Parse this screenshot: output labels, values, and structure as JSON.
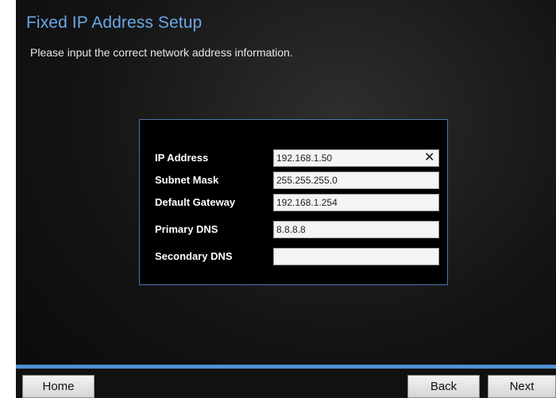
{
  "header": {
    "title": "Fixed IP Address Setup",
    "subtitle": "Please input the correct network address information."
  },
  "form": {
    "fields": [
      {
        "label": "IP Address",
        "value": "192.168.1.50"
      },
      {
        "label": "Subnet Mask",
        "value": "255.255.255.0"
      },
      {
        "label": "Default Gateway",
        "value": "192.168.1.254"
      },
      {
        "label": "Primary DNS",
        "value": "8.8.8.8"
      },
      {
        "label": "Secondary DNS",
        "value": ""
      }
    ],
    "clear_symbol": "✕"
  },
  "footer": {
    "home_label": "Home",
    "back_label": "Back",
    "next_label": "Next"
  },
  "colors": {
    "title": "#6aa8e6",
    "accent_bar": "#4f8fd4",
    "panel_border": "#4a78b0"
  }
}
